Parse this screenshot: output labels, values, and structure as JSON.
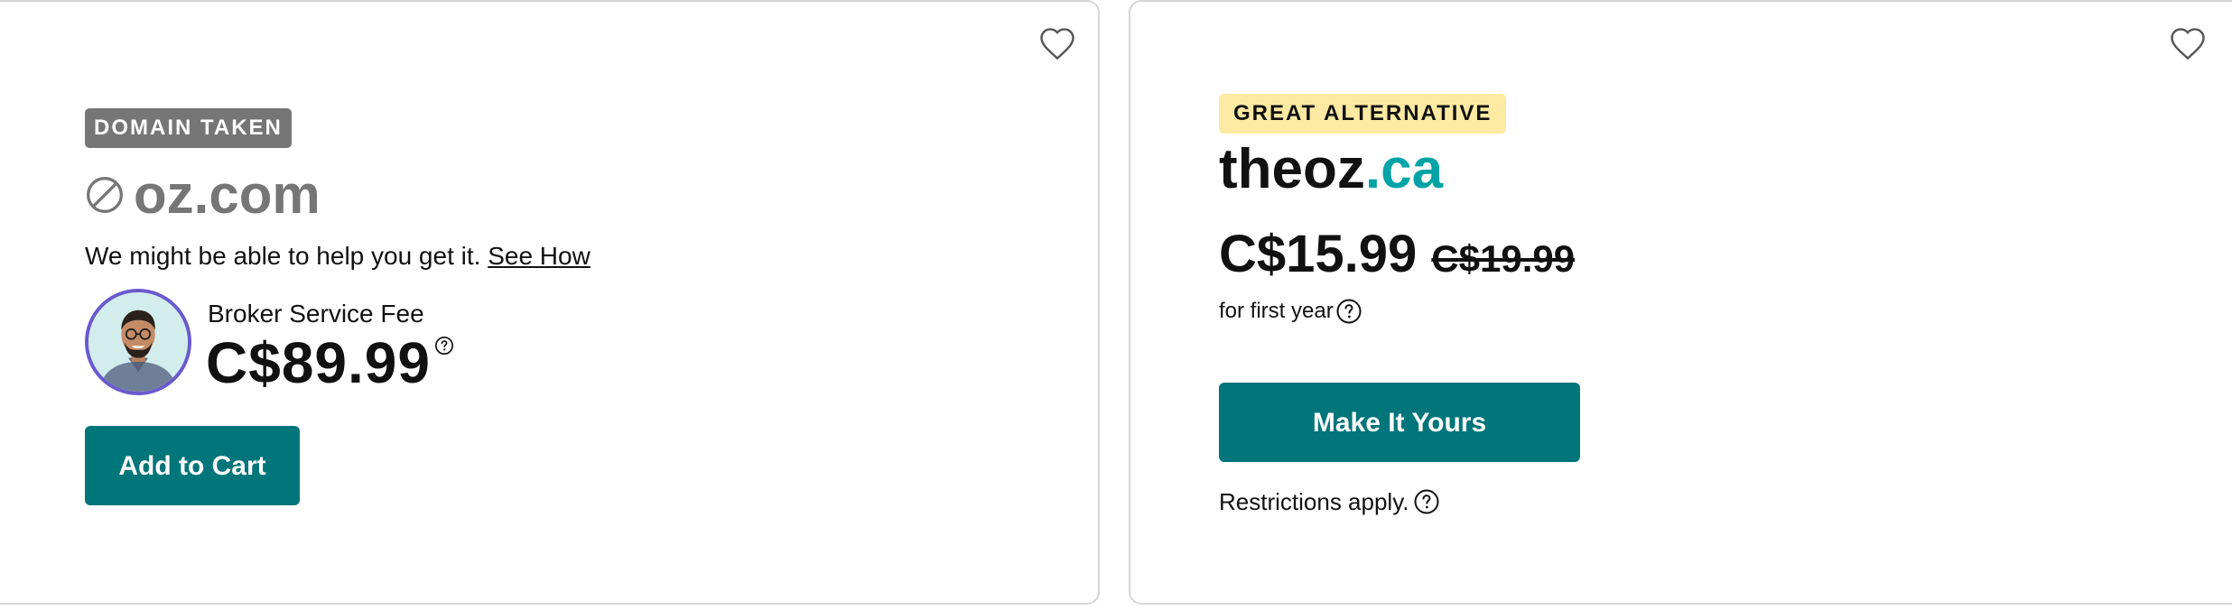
{
  "left_card": {
    "badge": "DOMAIN TAKEN",
    "domain": "oz.com",
    "help_text": "We might be able to help you get it.",
    "help_link": "See How",
    "broker_label": "Broker Service Fee",
    "broker_price": "C$89.99",
    "button_label": "Add to Cart",
    "icons": [
      "heart-outline-icon",
      "unavailable-icon",
      "question-circle-icon"
    ]
  },
  "right_card": {
    "badge": "GREAT ALTERNATIVE",
    "domain_name": "theoz",
    "domain_tld": ".ca",
    "price_current": "C$15.99",
    "price_original": "C$19.99",
    "term_text": "for first year",
    "button_label": "Make It Yours",
    "restrictions_text": "Restrictions apply.",
    "icons": [
      "heart-outline-icon",
      "question-circle-icon"
    ]
  },
  "colors": {
    "primary_button": "#00757a",
    "tld_accent": "#00a4a6",
    "taken_badge_bg": "#767676",
    "alternative_badge_bg": "#fdeaa2",
    "avatar_ring": "#6a5acd"
  }
}
